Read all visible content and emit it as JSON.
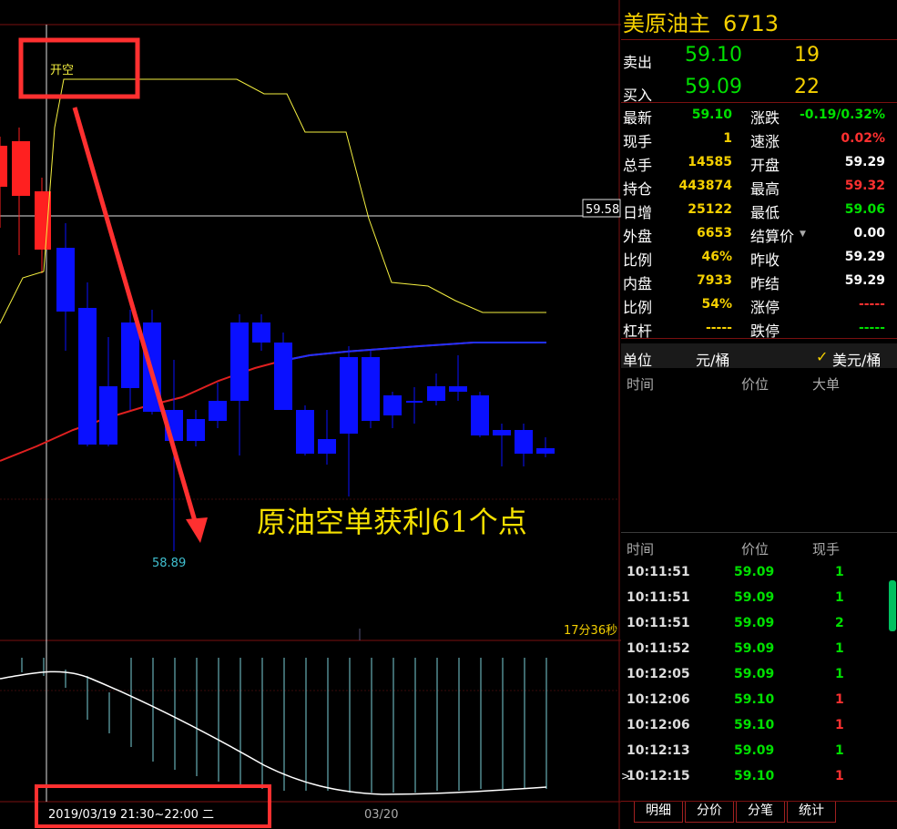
{
  "chart": {
    "open_short_label": "开空",
    "price_marker": "59.58",
    "low_label": "58.89",
    "annotation": "原油空单获利61个点",
    "countdown": "17分36秒",
    "date_range": "2019/03/19 21:30~22:00 二",
    "x_tick": "03/20",
    "colors": {
      "up": "#ff2020",
      "down": "#0a10ff",
      "ma_yellow": "#f5f040",
      "ma_red": "#e02020",
      "ma_blue": "#2030ff",
      "annotation": "#f5e000",
      "highlight": "#ff3030"
    }
  },
  "chart_data": {
    "type": "candlestick",
    "y_axis_marker": 59.58,
    "low_point": 58.89
  },
  "quote": {
    "title": "美原油主",
    "code": "6713",
    "ask_label": "卖出",
    "ask_price": "59.10",
    "ask_vol": "19",
    "bid_label": "买入",
    "bid_price": "59.09",
    "bid_vol": "22",
    "rows": [
      {
        "l1": "最新",
        "v1": "59.10",
        "c1": "#00e000",
        "l2": "涨跌",
        "v2": "-0.19/0.32%",
        "c2": "#00e000"
      },
      {
        "l1": "现手",
        "v1": "1",
        "c1": "#f5d000",
        "l2": "速涨",
        "v2": "0.02%",
        "c2": "#ff3030"
      },
      {
        "l1": "总手",
        "v1": "14585",
        "c1": "#f5d000",
        "l2": "开盘",
        "v2": "59.29",
        "c2": "#ffffff"
      },
      {
        "l1": "持仓",
        "v1": "443874",
        "c1": "#f5d000",
        "l2": "最高",
        "v2": "59.32",
        "c2": "#ff3030"
      },
      {
        "l1": "日增",
        "v1": "25122",
        "c1": "#f5d000",
        "l2": "最低",
        "v2": "59.06",
        "c2": "#00e000"
      },
      {
        "l1": "外盘",
        "v1": "6653",
        "c1": "#f5d000",
        "l2": "结算价",
        "v2": "0.00",
        "c2": "#ffffff"
      },
      {
        "l1": "比例",
        "v1": "46%",
        "c1": "#f5d000",
        "l2": "昨收",
        "v2": "59.29",
        "c2": "#ffffff"
      },
      {
        "l1": "内盘",
        "v1": "7933",
        "c1": "#f5d000",
        "l2": "昨结",
        "v2": "59.29",
        "c2": "#ffffff"
      },
      {
        "l1": "比例",
        "v1": "54%",
        "c1": "#f5d000",
        "l2": "涨停",
        "v2": "-----",
        "c2": "#ff3030"
      },
      {
        "l1": "杠杆",
        "v1": "-----",
        "c1": "#f5d000",
        "l2": "跌停",
        "v2": "-----",
        "c2": "#00e000"
      }
    ],
    "unit_label": "单位",
    "unit_value": "元/桶",
    "unit_option": "美元/桶",
    "bigorder_headers": {
      "time": "时间",
      "price": "价位",
      "big": "大单"
    },
    "ticks_headers": {
      "time": "时间",
      "price": "价位",
      "vol": "现手"
    },
    "ticks": [
      {
        "time": "10:11:51",
        "price": "59.09",
        "vol": "1",
        "vc": "#00e000"
      },
      {
        "time": "10:11:51",
        "price": "59.09",
        "vol": "1",
        "vc": "#00e000"
      },
      {
        "time": "10:11:51",
        "price": "59.09",
        "vol": "2",
        "vc": "#00e000"
      },
      {
        "time": "10:11:52",
        "price": "59.09",
        "vol": "1",
        "vc": "#00e000"
      },
      {
        "time": "10:12:05",
        "price": "59.09",
        "vol": "1",
        "vc": "#00e000"
      },
      {
        "time": "10:12:06",
        "price": "59.10",
        "vol": "1",
        "vc": "#ff3030"
      },
      {
        "time": "10:12:06",
        "price": "59.10",
        "vol": "1",
        "vc": "#ff3030"
      },
      {
        "time": "10:12:13",
        "price": "59.09",
        "vol": "1",
        "vc": "#00e000"
      },
      {
        "time": "10:12:15",
        "price": "59.10",
        "vol": "1",
        "vc": "#ff3030"
      }
    ],
    "tabs": [
      "明细",
      "分价",
      "分笔",
      "统计"
    ]
  }
}
